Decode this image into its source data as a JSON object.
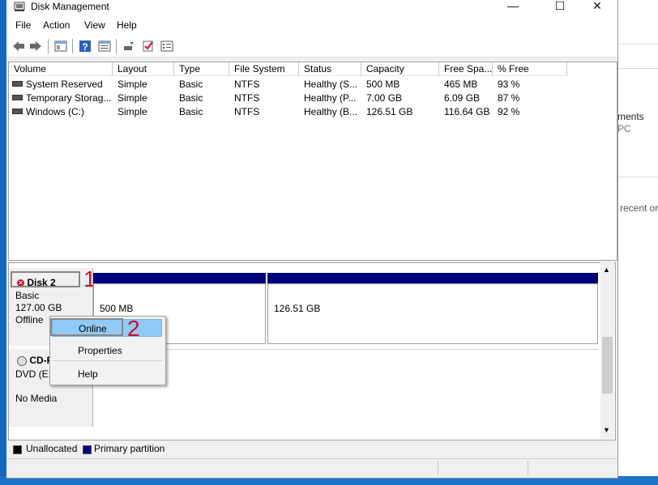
{
  "window": {
    "title": "Disk Management",
    "minimize": "—",
    "maximize": "☐",
    "close": "✕"
  },
  "menu": [
    "File",
    "Action",
    "View",
    "Help"
  ],
  "toolbar": {
    "icons": [
      "back-icon",
      "forward-icon",
      "console-tree-icon",
      "help-icon",
      "properties-icon",
      "rescan-icon",
      "check-icon",
      "list-icon"
    ]
  },
  "volume_table": {
    "headers": [
      "Volume",
      "Layout",
      "Type",
      "File System",
      "Status",
      "Capacity",
      "Free Spa...",
      "% Free"
    ],
    "rows": [
      [
        "System Reserved",
        "Simple",
        "Basic",
        "NTFS",
        "Healthy (S...",
        "500 MB",
        "465 MB",
        "93 %"
      ],
      [
        "Temporary Storag...",
        "Simple",
        "Basic",
        "NTFS",
        "Healthy (P...",
        "7.00 GB",
        "6.09 GB",
        "87 %"
      ],
      [
        "Windows (C:)",
        "Simple",
        "Basic",
        "NTFS",
        "Healthy (B...",
        "126.51 GB",
        "116.64 GB",
        "92 %"
      ]
    ]
  },
  "disks": [
    {
      "name": "Disk 2",
      "type": "Basic",
      "size": "127.00 GB",
      "state": "Offline",
      "partitions": [
        "500 MB",
        "126.51 GB"
      ]
    },
    {
      "name": "CD-ROM 0",
      "type": "DVD (E:)",
      "state": "No Media"
    }
  ],
  "legend": [
    {
      "label": "Unallocated",
      "color": "#000000"
    },
    {
      "label": "Primary partition",
      "color": "#00007f"
    }
  ],
  "context_menu": {
    "items": [
      "Online",
      "Properties",
      "Help"
    ]
  },
  "annotations": {
    "one": "1",
    "two": "2"
  },
  "background": {
    "line1": "ments",
    "line2": "PC",
    "line3": "recent or"
  }
}
